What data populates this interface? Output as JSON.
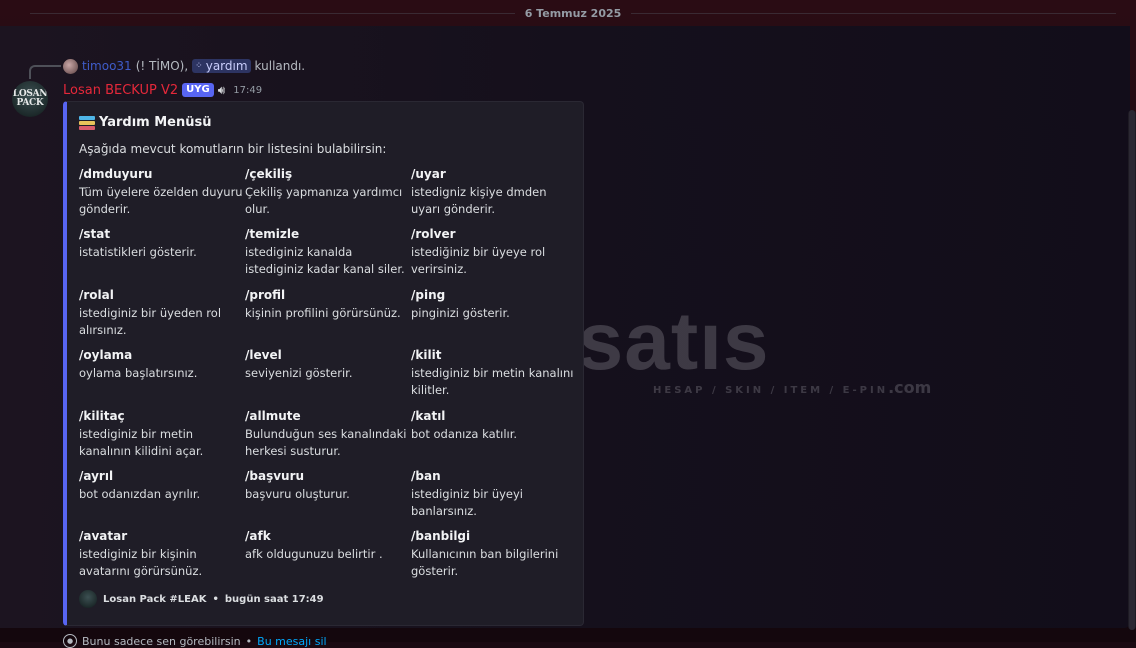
{
  "date_divider": "6 Temmuz 2025",
  "reply": {
    "user": "timoo31",
    "nick": "(! TİMO),",
    "command": "yardım",
    "action": "kullandı."
  },
  "message": {
    "avatar_text": [
      "LOSAN",
      "PACK"
    ],
    "username": "Losan BECKUP V2",
    "badge": "UYG",
    "time": "17:49"
  },
  "embed": {
    "title": "Yardım Menüsü",
    "description": "Aşağıda mevcut komutların bir listesini bulabilirsin:",
    "accent": "#5865f2",
    "fields": [
      {
        "name": "/dmduyuru",
        "value": "Tüm üyelere özelden duyuru gönderir."
      },
      {
        "name": "/çekiliş",
        "value": "Çekiliş yapmanıza yardımcı olur."
      },
      {
        "name": "/uyar",
        "value": "istedigniz kişiye dmden uyarı gönderir."
      },
      {
        "name": "/stat",
        "value": "istatistikleri gösterir."
      },
      {
        "name": "/temizle",
        "value": "istediginiz kanalda istediginiz kadar kanal siler."
      },
      {
        "name": "/rolver",
        "value": "istediğiniz bir üyeye rol verirsiniz."
      },
      {
        "name": "/rolal",
        "value": "istediginiz bir üyeden rol alırsınız."
      },
      {
        "name": "/profil",
        "value": "kişinin profilini görürsünüz."
      },
      {
        "name": "/ping",
        "value": "pinginizi gösterir."
      },
      {
        "name": "/oylama",
        "value": "oylama başlatırsınız."
      },
      {
        "name": "/level",
        "value": "seviyenizi gösterir."
      },
      {
        "name": "/kilit",
        "value": "istediginiz bir metin kanalını kilitler."
      },
      {
        "name": "/kilitaç",
        "value": "istediginiz bir metin kanalının kilidini açar."
      },
      {
        "name": "/allmute",
        "value": "Bulunduğun ses kanalındaki herkesi susturur."
      },
      {
        "name": "/katıl",
        "value": "bot odanıza katılır."
      },
      {
        "name": "/ayrıl",
        "value": "bot odanızdan ayrılır."
      },
      {
        "name": "/başvuru",
        "value": "başvuru oluşturur."
      },
      {
        "name": "/ban",
        "value": "istediginiz bir üyeyi banlarsınız."
      },
      {
        "name": "/avatar",
        "value": "istediginiz bir kişinin avatarını görürsünüz."
      },
      {
        "name": "/afk",
        "value": "afk oldugunuzu belirtir ."
      },
      {
        "name": "/banbilgi",
        "value": "Kullanıcının ban bilgilerini gösterir."
      }
    ],
    "footer": {
      "name": "Losan Pack #LEAK",
      "separator": "•",
      "time": "bugün saat 17:49"
    }
  },
  "ephemeral": {
    "text": "Bunu sadece sen görebilirsin",
    "separator": "•",
    "link": "Bu mesajı sil"
  },
  "watermark": {
    "text": "itemsatıs",
    "sub": "HESAP / SKIN / ITEM / E-PIN",
    "suffix": ".com"
  }
}
